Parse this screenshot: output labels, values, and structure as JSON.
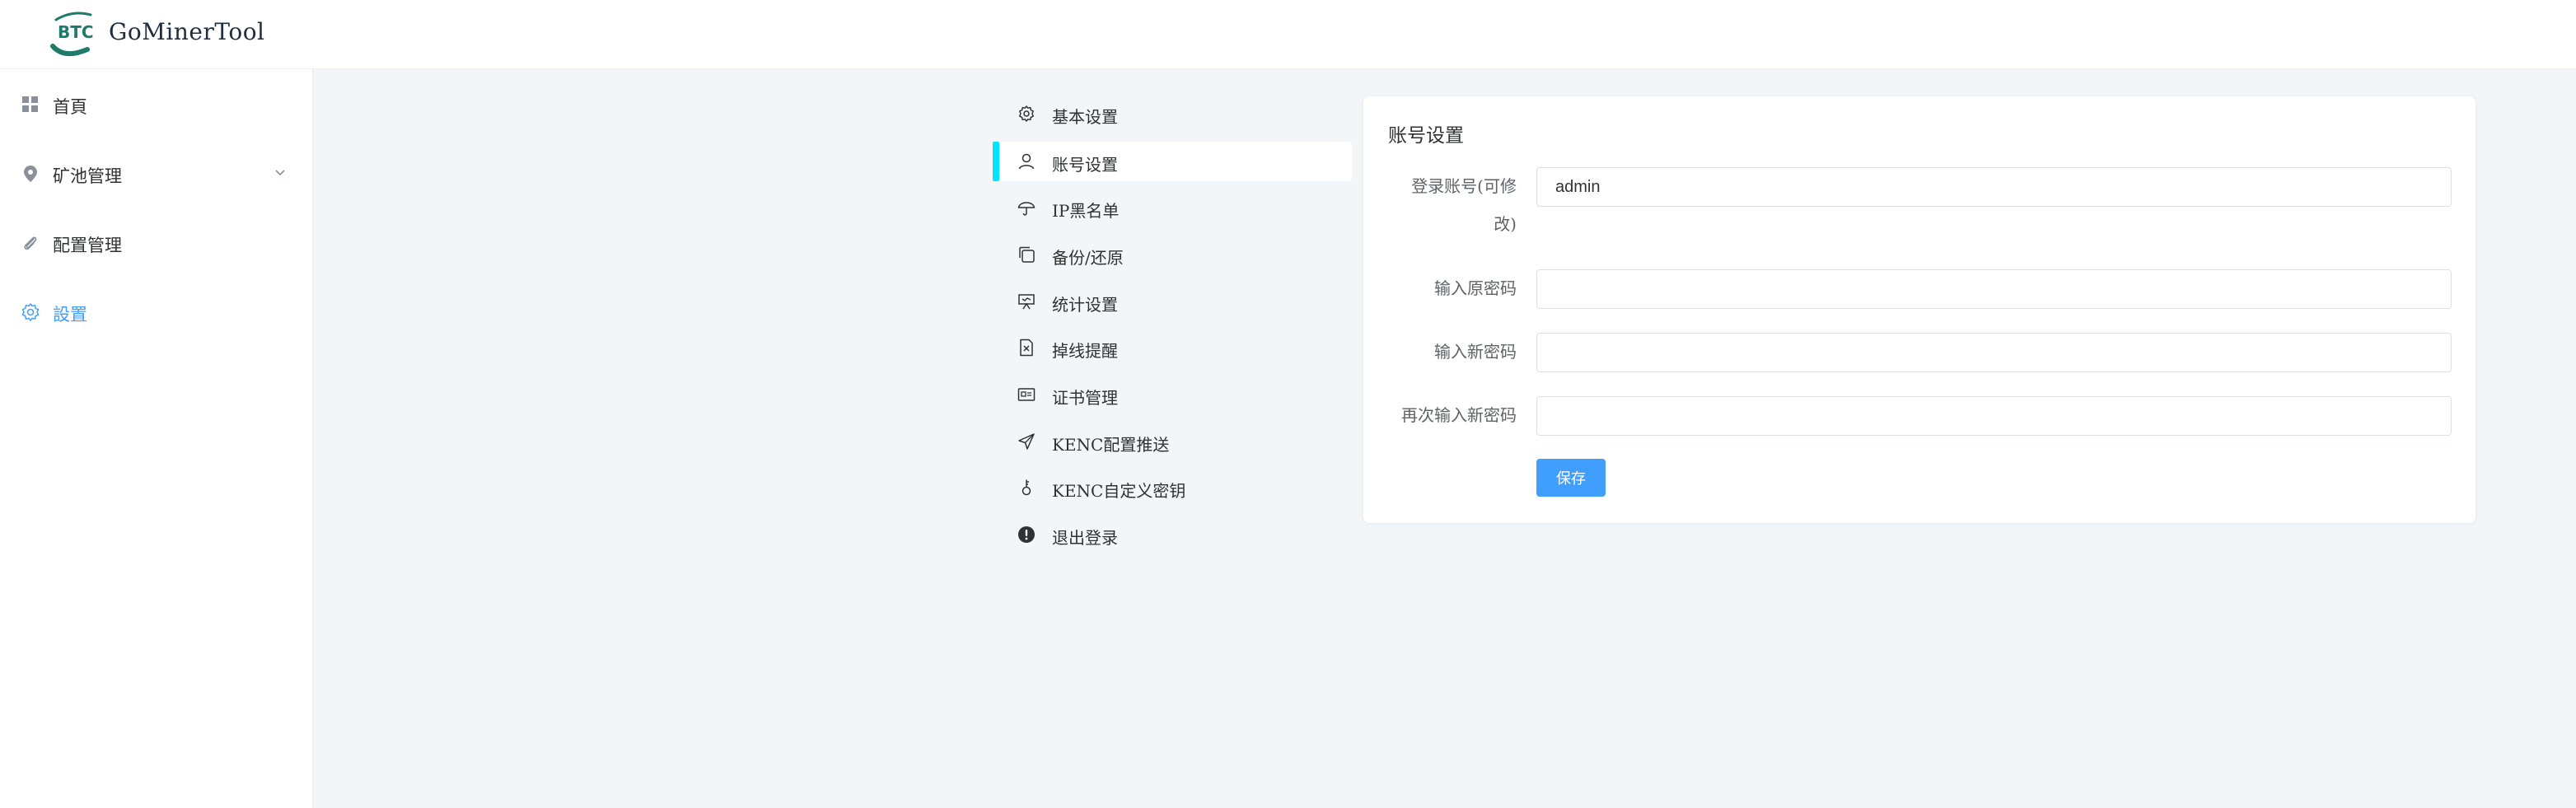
{
  "app": {
    "brand": "GoMinerTool",
    "logo_text": "BTC"
  },
  "colors": {
    "accent": "#409eff",
    "active_indicator": "#00e5ff",
    "logo_green": "#1f7a6a"
  },
  "sidebar": {
    "items": [
      {
        "label": "首頁",
        "icon": "dashboard-grid-icon"
      },
      {
        "label": "矿池管理",
        "icon": "location-pin-icon",
        "has_submenu": true
      },
      {
        "label": "配置管理",
        "icon": "paperclip-icon"
      },
      {
        "label": "設置",
        "icon": "gear-icon",
        "active": true
      }
    ]
  },
  "settings_menu": {
    "items": [
      {
        "label": "基本设置",
        "icon": "gear-icon"
      },
      {
        "label": "账号设置",
        "icon": "user-icon",
        "active": true
      },
      {
        "label": "IP黑名单",
        "icon": "umbrella-icon"
      },
      {
        "label": "备份/还原",
        "icon": "copy-icon"
      },
      {
        "label": "统计设置",
        "icon": "presentation-icon"
      },
      {
        "label": "掉线提醒",
        "icon": "document-x-icon"
      },
      {
        "label": "证书管理",
        "icon": "id-card-icon"
      },
      {
        "label": "KENC配置推送",
        "icon": "send-icon"
      },
      {
        "label": "KENC自定义密钥",
        "icon": "key-icon"
      },
      {
        "label": "退出登录",
        "icon": "warning-circle-icon"
      }
    ]
  },
  "account_form": {
    "title": "账号设置",
    "fields": [
      {
        "label_line1": "登录账号(可修",
        "label_line2": "改)",
        "value": "admin"
      },
      {
        "label": "输入原密码",
        "value": ""
      },
      {
        "label": "输入新密码",
        "value": ""
      },
      {
        "label": "再次输入新密码",
        "value": ""
      }
    ],
    "save_label": "保存"
  }
}
